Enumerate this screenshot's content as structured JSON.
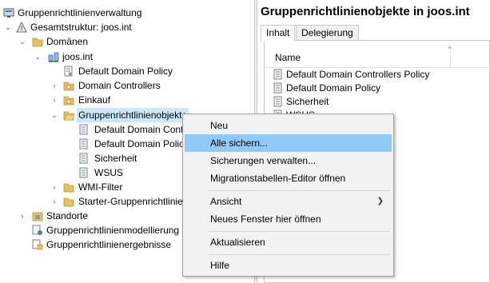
{
  "tree": {
    "items": [
      {
        "label": "Gruppenrichtlinienverwaltung",
        "icon": "gpm-console-icon",
        "toggle": ""
      },
      {
        "label": "Gesamtstruktur: joos.int",
        "icon": "forest-icon",
        "toggle": "expanded"
      },
      {
        "label": "Domänen",
        "icon": "folder-icon",
        "toggle": "expanded"
      },
      {
        "label": "joos.int",
        "icon": "domain-icon",
        "toggle": "expanded"
      },
      {
        "label": "Default Domain Policy",
        "icon": "gpo-link-icon",
        "toggle": ""
      },
      {
        "label": "Domain Controllers",
        "icon": "ou-folder-icon",
        "toggle": "collapsed"
      },
      {
        "label": "Einkauf",
        "icon": "ou-folder-icon",
        "toggle": "collapsed"
      },
      {
        "label": "Gruppenrichtlinienobjekte",
        "icon": "folder-open-icon",
        "toggle": "expanded"
      },
      {
        "label": "Default Domain Controllers Policy",
        "icon": "gpo-icon",
        "toggle": ""
      },
      {
        "label": "Default Domain Policy",
        "icon": "gpo-icon",
        "toggle": ""
      },
      {
        "label": "Sicherheit",
        "icon": "gpo-icon",
        "toggle": ""
      },
      {
        "label": "WSUS",
        "icon": "gpo-icon",
        "toggle": ""
      },
      {
        "label": "WMI-Filter",
        "icon": "folder-icon",
        "toggle": "collapsed"
      },
      {
        "label": "Starter-Gruppenrichtlinienobjekte",
        "icon": "folder-icon",
        "toggle": "collapsed"
      },
      {
        "label": "Standorte",
        "icon": "sites-icon",
        "toggle": "collapsed"
      },
      {
        "label": "Gruppenrichtlinienmodellierung",
        "icon": "modeling-icon",
        "toggle": ""
      },
      {
        "label": "Gruppenrichtlinienergebnisse",
        "icon": "results-icon",
        "toggle": ""
      }
    ]
  },
  "right": {
    "title": "Gruppenrichtlinienobjekte in joos.int",
    "tabs": [
      {
        "label": "Inhalt",
        "active": true
      },
      {
        "label": "Delegierung",
        "active": false
      }
    ],
    "column_header": "Name",
    "rows": [
      {
        "label": "Default Domain Controllers Policy"
      },
      {
        "label": "Default Domain Policy"
      },
      {
        "label": "Sicherheit"
      },
      {
        "label": "WSUS"
      }
    ]
  },
  "context_menu": {
    "items": [
      {
        "label": "Neu"
      },
      {
        "label": "Alle sichern...",
        "highlighted": true
      },
      {
        "label": "Sicherungen verwalten..."
      },
      {
        "label": "Migrationstabellen-Editor öffnen"
      },
      {
        "label": "Ansicht",
        "submenu": true
      },
      {
        "label": "Neues Fenster hier öffnen"
      },
      {
        "label": "Aktualisieren"
      },
      {
        "label": "Hilfe"
      }
    ]
  },
  "colors": {
    "selection": "#cce8ff",
    "menu_hover": "#91c9f7",
    "folder": "#e8c15a",
    "gpo": "#7f8fa6"
  }
}
